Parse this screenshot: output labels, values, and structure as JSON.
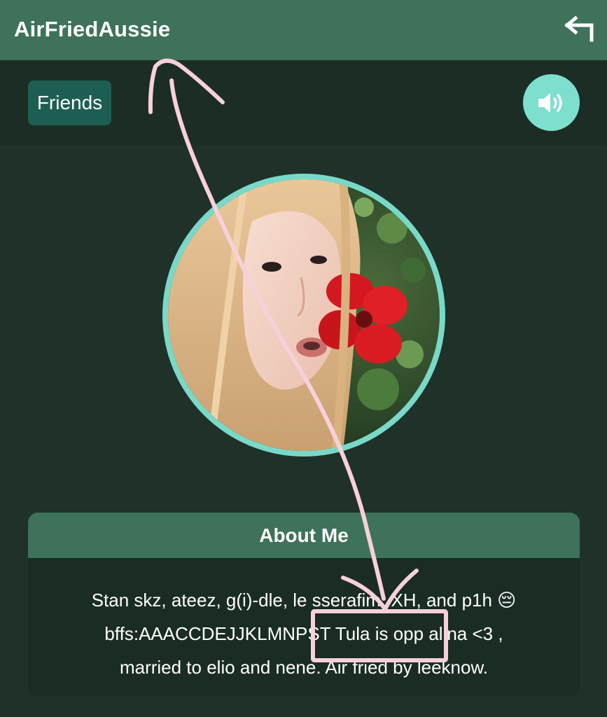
{
  "header": {
    "title": "AirFriedAussie",
    "back_icon": "return-arrow-icon"
  },
  "toolbar": {
    "friends_label": "Friends",
    "sound_icon": "speaker-volume-icon"
  },
  "profile": {
    "avatar_description": "profile-photo"
  },
  "about": {
    "heading": "About Me",
    "line1": "Stan skz, ateez, g(i)-dle, le sserafim, XH, and p1h 😔",
    "line2": "bffs:AAACCDEJJKLMNPST Tula is opp alina <3 ,",
    "line3": "married to elio and nene. Air fried by leeknow."
  },
  "colors": {
    "header": "#3e725a",
    "background": "#1f3129",
    "accent": "#7fdfcf",
    "friends_button": "#1e5e52",
    "annotation": "#f8d0dc"
  }
}
